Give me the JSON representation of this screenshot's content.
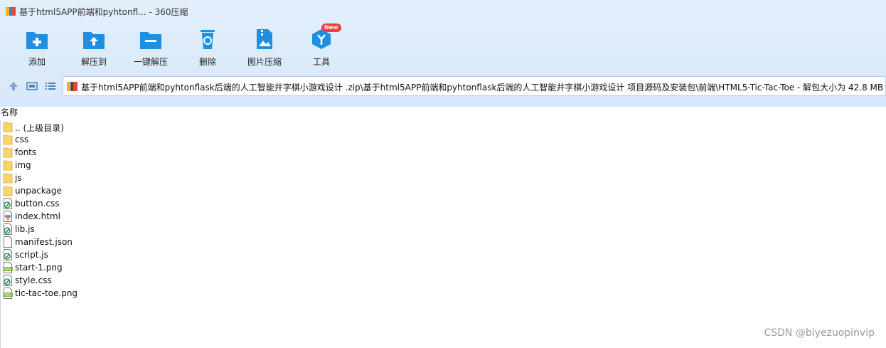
{
  "window": {
    "title": "基于html5APP前端和pyhtonfl... - 360压缩"
  },
  "toolbar": {
    "buttons": [
      {
        "label": "添加",
        "icon": "add-folder-icon"
      },
      {
        "label": "解压到",
        "icon": "extract-to-icon"
      },
      {
        "label": "一键解压",
        "icon": "one-click-extract-icon"
      },
      {
        "label": "删除",
        "icon": "delete-icon"
      },
      {
        "label": "图片压缩",
        "icon": "image-compress-icon"
      },
      {
        "label": "工具",
        "icon": "tools-icon",
        "badge": "New"
      }
    ]
  },
  "path": {
    "text": "基于html5APP前端和pyhtonflask后端的人工智能井字棋小游戏设计 .zip\\基于html5APP前端和pyhtonflask后端的人工智能井字棋小游戏设计 项目源码及安装包\\前端\\HTML5-Tic-Tac-Toe - 解包大小为 42.8 MB"
  },
  "list": {
    "header": "名称",
    "items": [
      {
        "name": ".. (上级目录)",
        "type": "folder"
      },
      {
        "name": "css",
        "type": "folder"
      },
      {
        "name": "fonts",
        "type": "folder"
      },
      {
        "name": "img",
        "type": "folder"
      },
      {
        "name": "js",
        "type": "folder"
      },
      {
        "name": "unpackage",
        "type": "folder"
      },
      {
        "name": "button.css",
        "type": "script"
      },
      {
        "name": "index.html",
        "type": "html"
      },
      {
        "name": "lib.js",
        "type": "script"
      },
      {
        "name": "manifest.json",
        "type": "file"
      },
      {
        "name": "script.js",
        "type": "script"
      },
      {
        "name": "start-1.png",
        "type": "png"
      },
      {
        "name": "style.css",
        "type": "script"
      },
      {
        "name": "tic-tac-toe.png",
        "type": "png"
      }
    ]
  },
  "watermark": "CSDN @biyezuopinvip",
  "colors": {
    "accent": "#1e8fe1",
    "toolbar_bg": "#dbeafb"
  }
}
